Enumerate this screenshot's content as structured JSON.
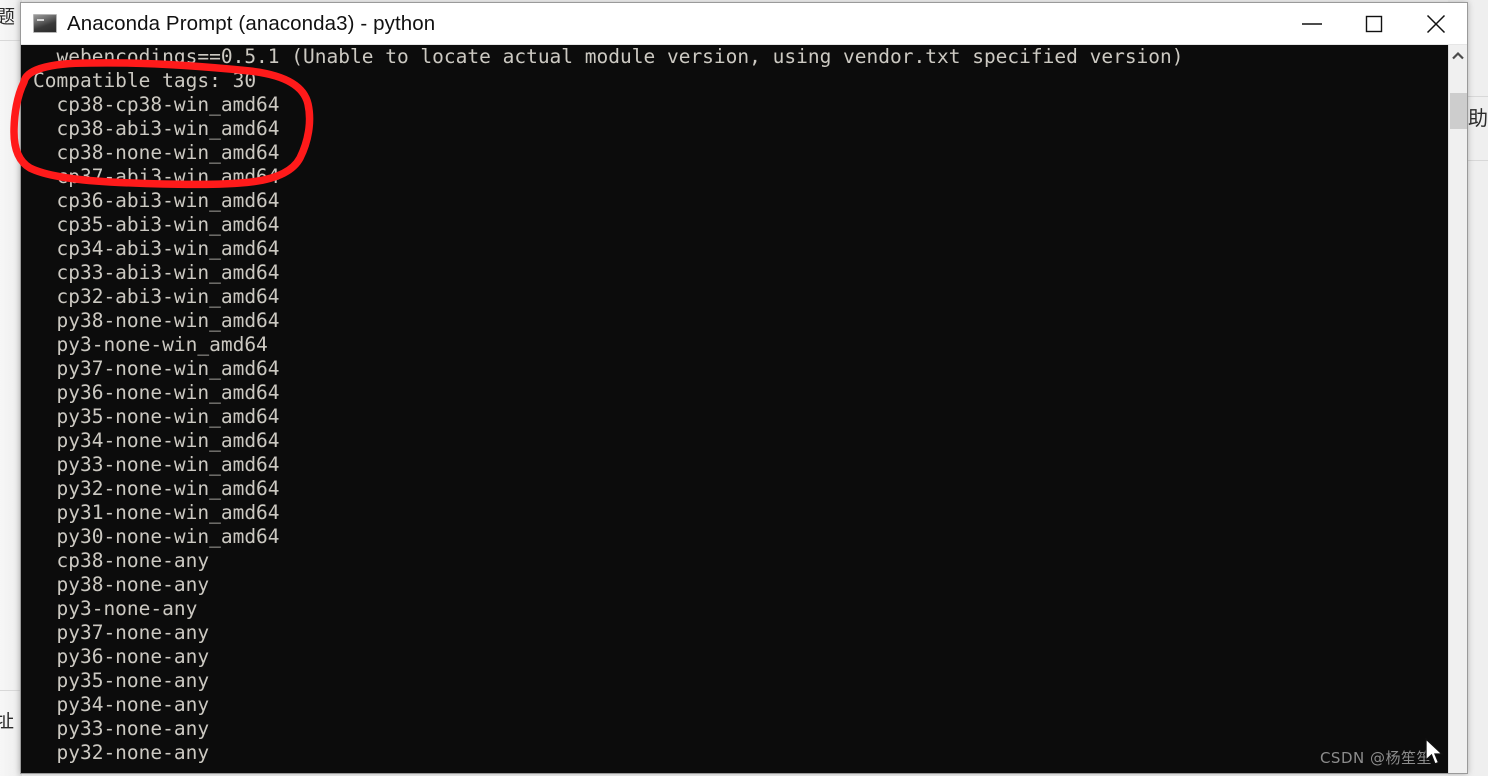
{
  "window": {
    "title": "Anaconda Prompt (anaconda3) - python",
    "icon": "console-icon",
    "controls": {
      "minimize": "minimize-icon",
      "maximize": "maximize-icon",
      "close": "close-icon"
    }
  },
  "console": {
    "background_color": "#0c0c0c",
    "text_color": "#ccc9c2",
    "lines": [
      "  webencodings==0.5.1 (Unable to locate actual module version, using vendor.txt specified version)",
      "Compatible tags: 30",
      "  cp38-cp38-win_amd64",
      "  cp38-abi3-win_amd64",
      "  cp38-none-win_amd64",
      "  cp37-abi3-win_amd64",
      "  cp36-abi3-win_amd64",
      "  cp35-abi3-win_amd64",
      "  cp34-abi3-win_amd64",
      "  cp33-abi3-win_amd64",
      "  cp32-abi3-win_amd64",
      "  py38-none-win_amd64",
      "  py3-none-win_amd64",
      "  py37-none-win_amd64",
      "  py36-none-win_amd64",
      "  py35-none-win_amd64",
      "  py34-none-win_amd64",
      "  py33-none-win_amd64",
      "  py32-none-win_amd64",
      "  py31-none-win_amd64",
      "  py30-none-win_amd64",
      "  cp38-none-any",
      "  py38-none-any",
      "  py3-none-any",
      "  py37-none-any",
      "  py36-none-any",
      "  py35-none-any",
      "  py34-none-any",
      "  py33-none-any",
      "  py32-none-any"
    ]
  },
  "scrollbar": {
    "up_arrow": "chevron-up-icon",
    "thumb": "scrollbar-thumb"
  },
  "annotation": {
    "color": "#ff0000",
    "shape": "hand-drawn-ellipse",
    "encircles": [
      "Compatible tags: 30",
      "cp38-cp38-win_amd64",
      "cp38-abi3-win_amd64",
      "cp38-none-win_amd64",
      "cp37-abi3-win_amd64"
    ]
  },
  "background": {
    "glyph_top_left": "题",
    "glyph_bottom_left": "址",
    "glyph_right": "助"
  },
  "watermark": {
    "text": "CSDN @杨笙笙"
  }
}
